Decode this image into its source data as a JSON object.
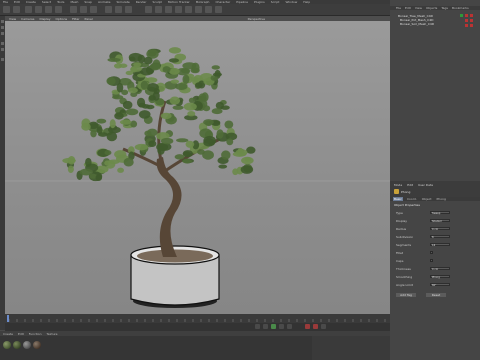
{
  "menu": [
    "File",
    "Edit",
    "Create",
    "Select",
    "Tools",
    "Mesh",
    "Snap",
    "Animate",
    "Simulate",
    "Render",
    "Sculpt",
    "Motion Tracker",
    "MoGraph",
    "Character",
    "Pipeline",
    "Plugins",
    "Script",
    "Window",
    "Help"
  ],
  "viewport": {
    "menu": [
      "View",
      "Cameras",
      "Display",
      "Options",
      "Filter",
      "Panel"
    ],
    "label": "Perspective"
  },
  "objects": [
    "Bonsai_Tree_Mesh_C4D",
    "Bonsai_Pot_Mesh_C4D",
    "Bonsai_Soil_Mesh_C4D"
  ],
  "right_tabs": [
    "File",
    "Edit",
    "View",
    "Objects",
    "Tags",
    "Bookmarks"
  ],
  "attr": {
    "menu": [
      "Mode",
      "Edit",
      "User Data"
    ],
    "object_name": "Phong",
    "tabs": [
      "Basic",
      "Coord.",
      "Object",
      "Phong"
    ],
    "section": "Object Properties",
    "rows": [
      {
        "label": "Type",
        "value": "Sweep"
      },
      {
        "label": "Display",
        "value": "Shaded"
      },
      {
        "label": "Radius",
        "value": "0 cm"
      },
      {
        "label": "Subdivision",
        "value": "8"
      },
      {
        "label": "Segments",
        "value": "16"
      },
      {
        "label": "Fillet",
        "value": ""
      },
      {
        "label": "Caps",
        "value": ""
      },
      {
        "label": "Thickness",
        "value": "0 cm"
      },
      {
        "label": "Smoothing",
        "value": "Phong"
      },
      {
        "label": "Angle Limit",
        "value": "80°"
      }
    ],
    "buttons": [
      "Add Tag",
      "Reset"
    ]
  },
  "materials_menu": [
    "Create",
    "Edit",
    "Function",
    "Texture"
  ],
  "colors": {
    "foliage": "#4f6b37",
    "trunk": "#5a4a3a",
    "pot": "#c8c8c8",
    "accent": "#6b7b95"
  }
}
